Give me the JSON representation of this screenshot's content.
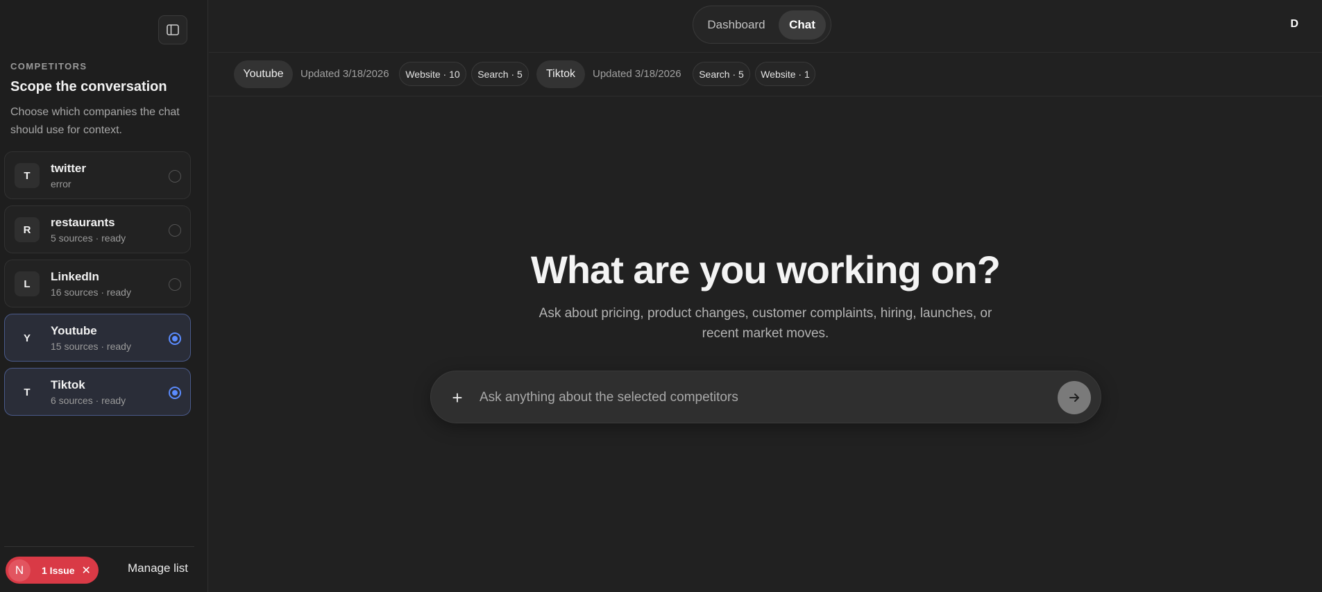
{
  "sidebar": {
    "eyebrow": "COMPETITORS",
    "title": "Scope the conversation",
    "description": "Choose which companies the chat should use for context.",
    "competitors": [
      {
        "initial": "T",
        "name": "twitter",
        "status": "error",
        "selected": false
      },
      {
        "initial": "R",
        "name": "restaurants",
        "status": "5 sources · ready",
        "selected": false
      },
      {
        "initial": "L",
        "name": "LinkedIn",
        "status": "16 sources · ready",
        "selected": false
      },
      {
        "initial": "Y",
        "name": "Youtube",
        "status": "15 sources · ready",
        "selected": true
      },
      {
        "initial": "T",
        "name": "Tiktok",
        "status": "6 sources · ready",
        "selected": true
      }
    ],
    "issue_badge": {
      "avatar": "N",
      "label": "1 Issue"
    },
    "manage_label": "Manage list"
  },
  "topbar": {
    "tabs": [
      {
        "label": "Dashboard",
        "active": false
      },
      {
        "label": "Chat",
        "active": true
      }
    ],
    "user_initial": "D"
  },
  "context": {
    "companies": [
      {
        "name": "Youtube",
        "updated": "Updated 3/18/2026",
        "sources": [
          "Website · 10",
          "Search · 5"
        ]
      },
      {
        "name": "Tiktok",
        "updated": "Updated 3/18/2026",
        "sources": [
          "Search · 5",
          "Website · 1"
        ]
      }
    ]
  },
  "hero": {
    "title": "What are you working on?",
    "subtitle": "Ask about pricing, product changes, customer complaints, hiring, launches, or recent market moves."
  },
  "composer": {
    "placeholder": "Ask anything about the selected competitors",
    "value": ""
  },
  "colors": {
    "background": "#212121",
    "accent": "#5b8cff",
    "issue": "#d93a46"
  }
}
